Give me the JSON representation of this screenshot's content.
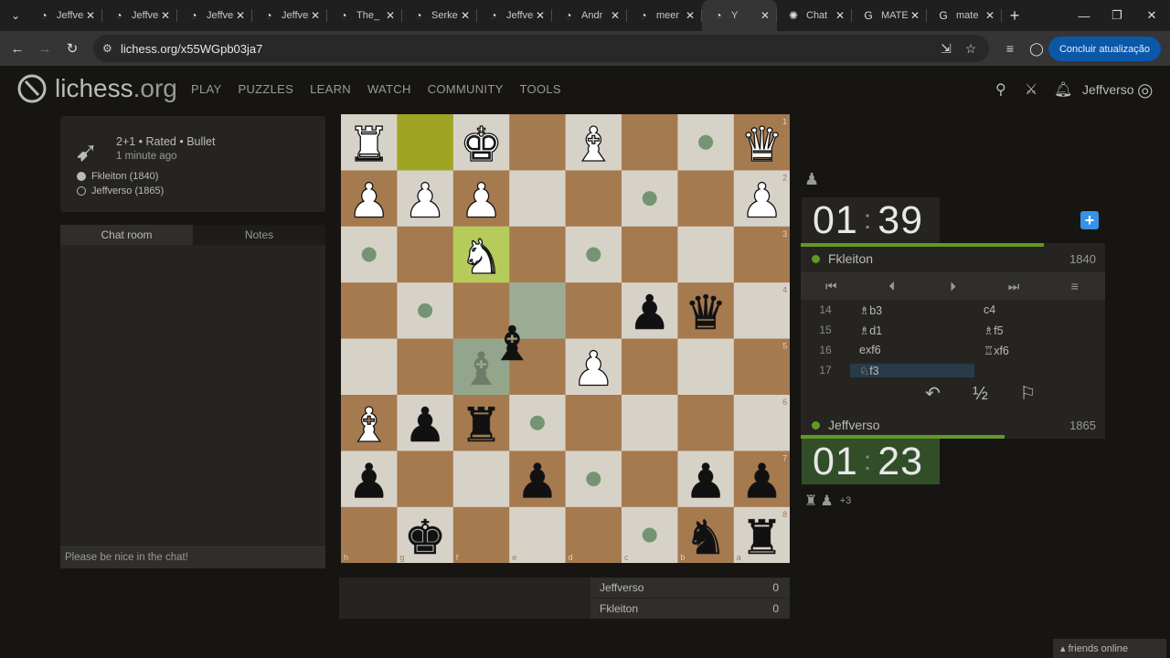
{
  "browser": {
    "tabs": [
      {
        "title": "Jeffverso",
        "icon": "lichess-icon"
      },
      {
        "title": "Jeffverso",
        "icon": "lichess-icon"
      },
      {
        "title": "Jeffverso",
        "icon": "lichess-icon"
      },
      {
        "title": "Jeffverso",
        "icon": "lichess-icon"
      },
      {
        "title": "The_",
        "icon": "lichess-icon"
      },
      {
        "title": "Serke",
        "icon": "lichess-icon"
      },
      {
        "title": "Jeffverso",
        "icon": "lichess-icon"
      },
      {
        "title": "Andr",
        "icon": "lichess-icon"
      },
      {
        "title": "meer",
        "icon": "lichess-icon"
      },
      {
        "title": "Y",
        "icon": "lichess-icon",
        "active": true
      },
      {
        "title": "Chat",
        "icon": "chatgpt-icon"
      },
      {
        "title": "MATE",
        "icon": "google-icon"
      },
      {
        "title": "mate",
        "icon": "google-icon"
      }
    ],
    "url": "lichess.org/x55WGpb03ja7",
    "update_button": "Concluir atualização"
  },
  "site": {
    "logo_main": "lichess",
    "logo_tld": ".org",
    "nav": [
      "PLAY",
      "PUZZLES",
      "LEARN",
      "WATCH",
      "COMMUNITY",
      "TOOLS"
    ],
    "username": "Jeffverso"
  },
  "game": {
    "setup": "2+1 • Rated • Bullet",
    "time_ago": "1 minute ago",
    "white_player": "Fkleiton (1840)",
    "black_player": "Jeffverso (1865)"
  },
  "chat": {
    "tab_chat": "Chat room",
    "tab_notes": "Notes",
    "placeholder": "Please be nice in the chat!"
  },
  "board": {
    "files": [
      "h",
      "g",
      "f",
      "e",
      "d",
      "c",
      "b",
      "a"
    ],
    "ranks": [
      "1",
      "2",
      "3",
      "4",
      "5",
      "6",
      "7",
      "8"
    ],
    "pieces": [
      {
        "sq": "h1",
        "p": "R",
        "c": "w"
      },
      {
        "sq": "f1",
        "p": "K",
        "c": "w"
      },
      {
        "sq": "d1",
        "p": "B",
        "c": "w"
      },
      {
        "sq": "a1",
        "p": "Q",
        "c": "w"
      },
      {
        "sq": "h2",
        "p": "P",
        "c": "w"
      },
      {
        "sq": "g2",
        "p": "P",
        "c": "w"
      },
      {
        "sq": "f2",
        "p": "P",
        "c": "w"
      },
      {
        "sq": "a2",
        "p": "P",
        "c": "w"
      },
      {
        "sq": "f3",
        "p": "N",
        "c": "w"
      },
      {
        "sq": "c4",
        "p": "P",
        "c": "b"
      },
      {
        "sq": "b4",
        "p": "Q",
        "c": "b"
      },
      {
        "sq": "d5",
        "p": "P",
        "c": "w"
      },
      {
        "sq": "h6",
        "p": "B",
        "c": "w"
      },
      {
        "sq": "g6",
        "p": "P",
        "c": "b"
      },
      {
        "sq": "f6",
        "p": "R",
        "c": "b"
      },
      {
        "sq": "h7",
        "p": "P",
        "c": "b"
      },
      {
        "sq": "e7",
        "p": "P",
        "c": "b"
      },
      {
        "sq": "b7",
        "p": "P",
        "c": "b"
      },
      {
        "sq": "a7",
        "p": "P",
        "c": "b"
      },
      {
        "sq": "g8",
        "p": "K",
        "c": "b"
      },
      {
        "sq": "b8",
        "p": "N",
        "c": "b"
      },
      {
        "sq": "a8",
        "p": "R",
        "c": "b"
      }
    ],
    "dragging": {
      "p": "B",
      "c": "b",
      "from": "f5"
    },
    "last_move": [
      "g1",
      "f3"
    ],
    "hover": "e4",
    "move_dots": [
      "b1",
      "c2",
      "h3",
      "d3",
      "g4",
      "e6",
      "d7",
      "c8"
    ],
    "colors": {
      "light": "#d7d2c8",
      "dark": "#a67a4f",
      "last_move": "#9bc700",
      "select": "#14551e"
    }
  },
  "clocks": {
    "top": {
      "min": "01",
      "sec": "39",
      "name": "Fkleiton",
      "rating": "1840",
      "bar_fraction": 0.8
    },
    "bottom": {
      "min": "01",
      "sec": "23",
      "name": "Jeffverso",
      "rating": "1865",
      "bar_fraction": 0.67
    }
  },
  "moves": [
    {
      "n": "14",
      "w": "♗b3",
      "b": "c4"
    },
    {
      "n": "15",
      "w": "♗d1",
      "b": "♗f5"
    },
    {
      "n": "16",
      "w": "exf6",
      "b": "♖xf6"
    },
    {
      "n": "17",
      "w": "♘f3",
      "b": ""
    }
  ],
  "material": {
    "advantage": "+3"
  },
  "score": [
    {
      "name": "Jeffverso",
      "value": "0"
    },
    {
      "name": "Fkleiton",
      "value": "0"
    }
  ],
  "friends": "friends online"
}
